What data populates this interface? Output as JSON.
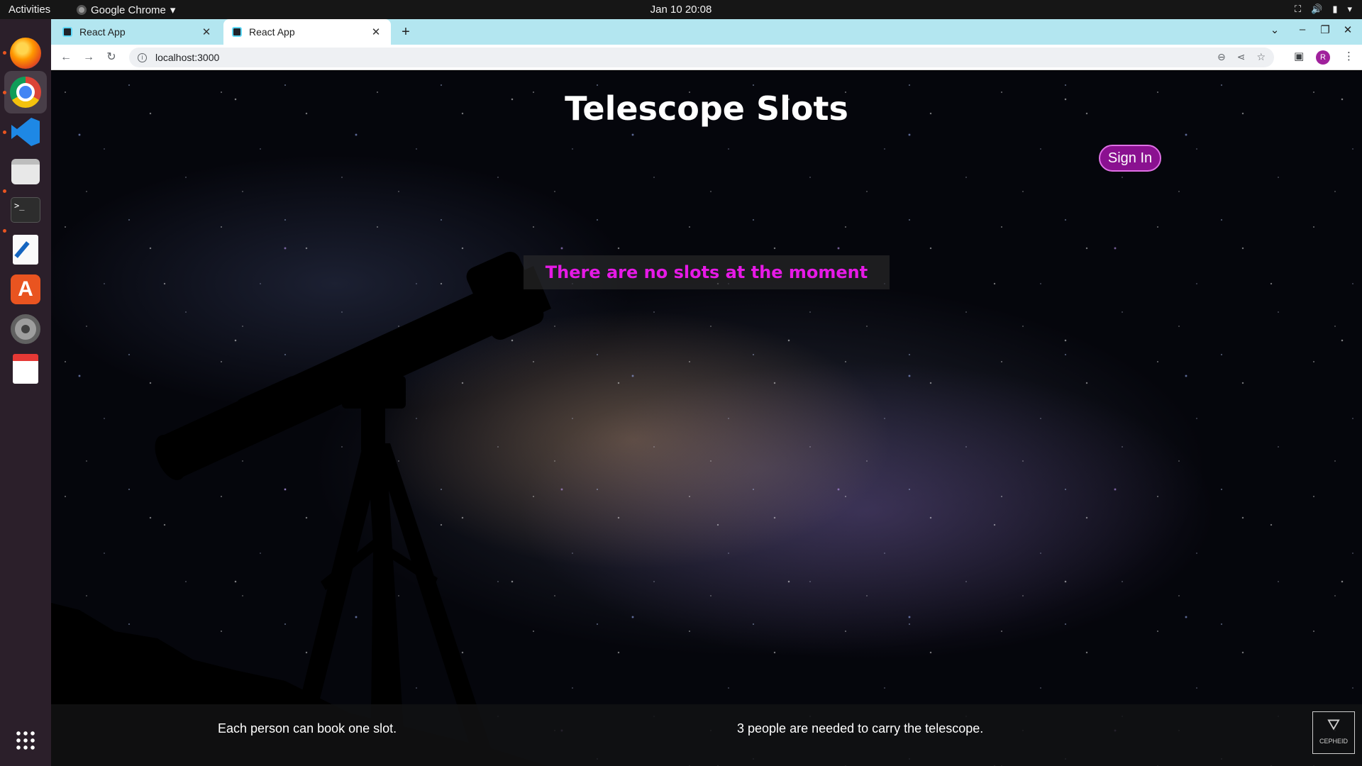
{
  "system_bar": {
    "activities": "Activities",
    "app_name": "Google Chrome",
    "clock": "Jan 10  20:08"
  },
  "dock": {
    "apps": [
      {
        "name": "firefox-icon"
      },
      {
        "name": "chrome-icon"
      },
      {
        "name": "vscode-icon"
      },
      {
        "name": "files-icon"
      },
      {
        "name": "terminal-icon"
      },
      {
        "name": "text-editor-icon"
      },
      {
        "name": "app-store-icon"
      },
      {
        "name": "settings-icon"
      },
      {
        "name": "document-viewer-icon"
      },
      {
        "name": "show-apps-icon"
      }
    ]
  },
  "browser": {
    "tabs": [
      {
        "title": "React App",
        "active": false
      },
      {
        "title": "React App",
        "active": true
      }
    ],
    "url": "localhost:3000",
    "profile_initial": "R"
  },
  "page": {
    "title": "Telescope Slots",
    "sign_in": "Sign In",
    "empty_message": "There are no slots at the moment",
    "footer": {
      "note_left": "Each person can book one slot.",
      "note_right": "3 people are needed to carry the telescope.",
      "logo_text": "CEPHEID"
    }
  },
  "colors": {
    "accent": "#e619e6",
    "sign_in_bg": "#8a1190",
    "tab_strip": "#b3e6f0"
  }
}
